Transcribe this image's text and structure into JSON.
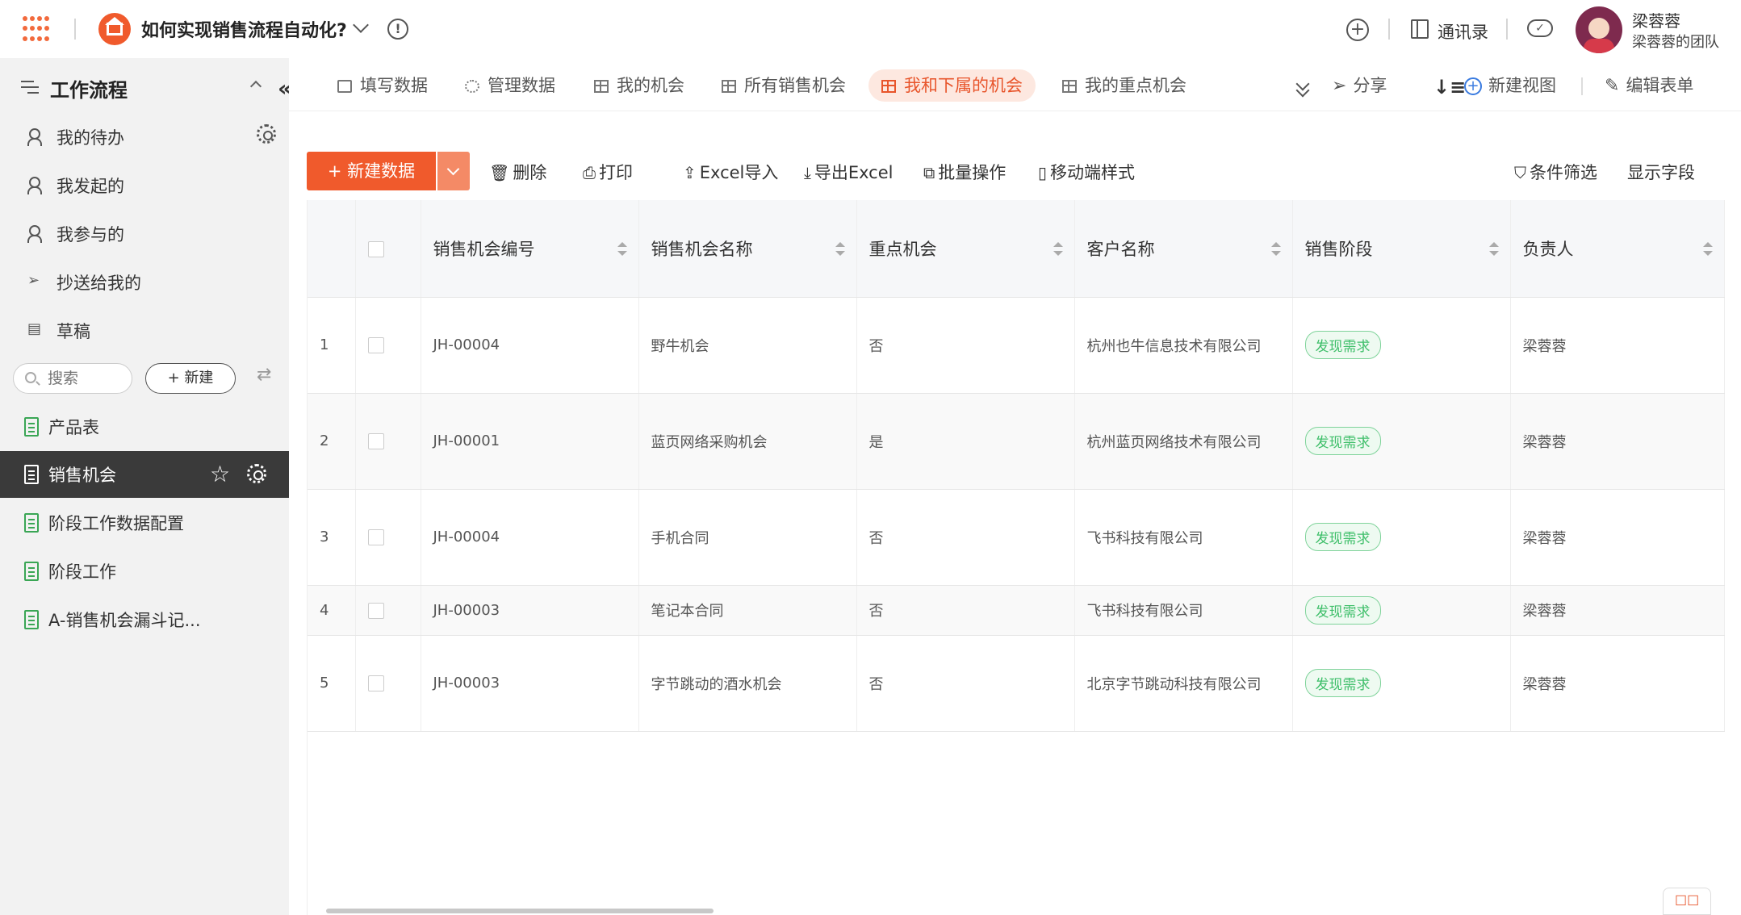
{
  "header": {
    "app_title": "如何实现销售流程自动化?",
    "contacts_label": "通讯录",
    "user_name": "梁蓉蓉",
    "user_team": "梁蓉蓉的团队"
  },
  "sidebar": {
    "title": "工作流程",
    "items": [
      {
        "label": "我的待办",
        "icon": "todo-person-icon"
      },
      {
        "label": "我发起的",
        "icon": "person-send-icon"
      },
      {
        "label": "我参与的",
        "icon": "person-plus-icon"
      },
      {
        "label": "抄送给我的",
        "icon": "paper-plane-icon"
      },
      {
        "label": "草稿",
        "icon": "draft-icon"
      }
    ],
    "search_placeholder": "搜索",
    "new_label": "+ 新建",
    "docs": [
      {
        "label": "产品表",
        "active": false
      },
      {
        "label": "销售机会",
        "active": true
      },
      {
        "label": "阶段工作数据配置",
        "active": false
      },
      {
        "label": "阶段工作",
        "active": false
      },
      {
        "label": "A-销售机会漏斗记...",
        "active": false
      }
    ]
  },
  "tabs": [
    {
      "label": "填写数据",
      "icon": "edit-icon"
    },
    {
      "label": "管理数据",
      "icon": "gear-icon"
    },
    {
      "label": "我的机会",
      "icon": "table-icon"
    },
    {
      "label": "所有销售机会",
      "icon": "table-icon"
    },
    {
      "label": "我和下属的机会",
      "icon": "table-icon",
      "active": true
    },
    {
      "label": "我的重点机会",
      "icon": "table-icon"
    }
  ],
  "tab_actions": {
    "share": "分享",
    "new_view": "新建视图",
    "edit_form": "编辑表单"
  },
  "toolbar": {
    "add": "+ 新建数据",
    "delete": "删除",
    "print": "打印",
    "import": "Excel导入",
    "export": "导出Excel",
    "batch": "批量操作",
    "mobile": "移动端样式",
    "filter": "条件筛选",
    "fields": "显示字段"
  },
  "table": {
    "columns": [
      "销售机会编号",
      "销售机会名称",
      "重点机会",
      "客户名称",
      "销售阶段",
      "负责人"
    ],
    "rows": [
      {
        "n": "1",
        "id": "JH-00004",
        "name": "野牛机会",
        "key": "否",
        "customer": "杭州也牛信息技术有限公司",
        "stage": "发现需求",
        "owner": "梁蓉蓉"
      },
      {
        "n": "2",
        "id": "JH-00001",
        "name": "蓝页网络采购机会",
        "key": "是",
        "customer": "杭州蓝页网络技术有限公司",
        "stage": "发现需求",
        "owner": "梁蓉蓉"
      },
      {
        "n": "3",
        "id": "JH-00004",
        "name": "手机合同",
        "key": "否",
        "customer": "飞书科技有限公司",
        "stage": "发现需求",
        "owner": "梁蓉蓉"
      },
      {
        "n": "4",
        "id": "JH-00003",
        "name": "笔记本合同",
        "key": "否",
        "customer": "飞书科技有限公司",
        "stage": "发现需求",
        "owner": "梁蓉蓉"
      },
      {
        "n": "5",
        "id": "JH-00003",
        "name": "字节跳动的酒水机会",
        "key": "否",
        "customer": "北京字节跳动科技有限公司",
        "stage": "发现需求",
        "owner": "梁蓉蓉"
      }
    ]
  },
  "colors": {
    "accent": "#f05a2c",
    "stage_green": "#3fbf6a",
    "sidebar_active": "#3a3a3a"
  }
}
